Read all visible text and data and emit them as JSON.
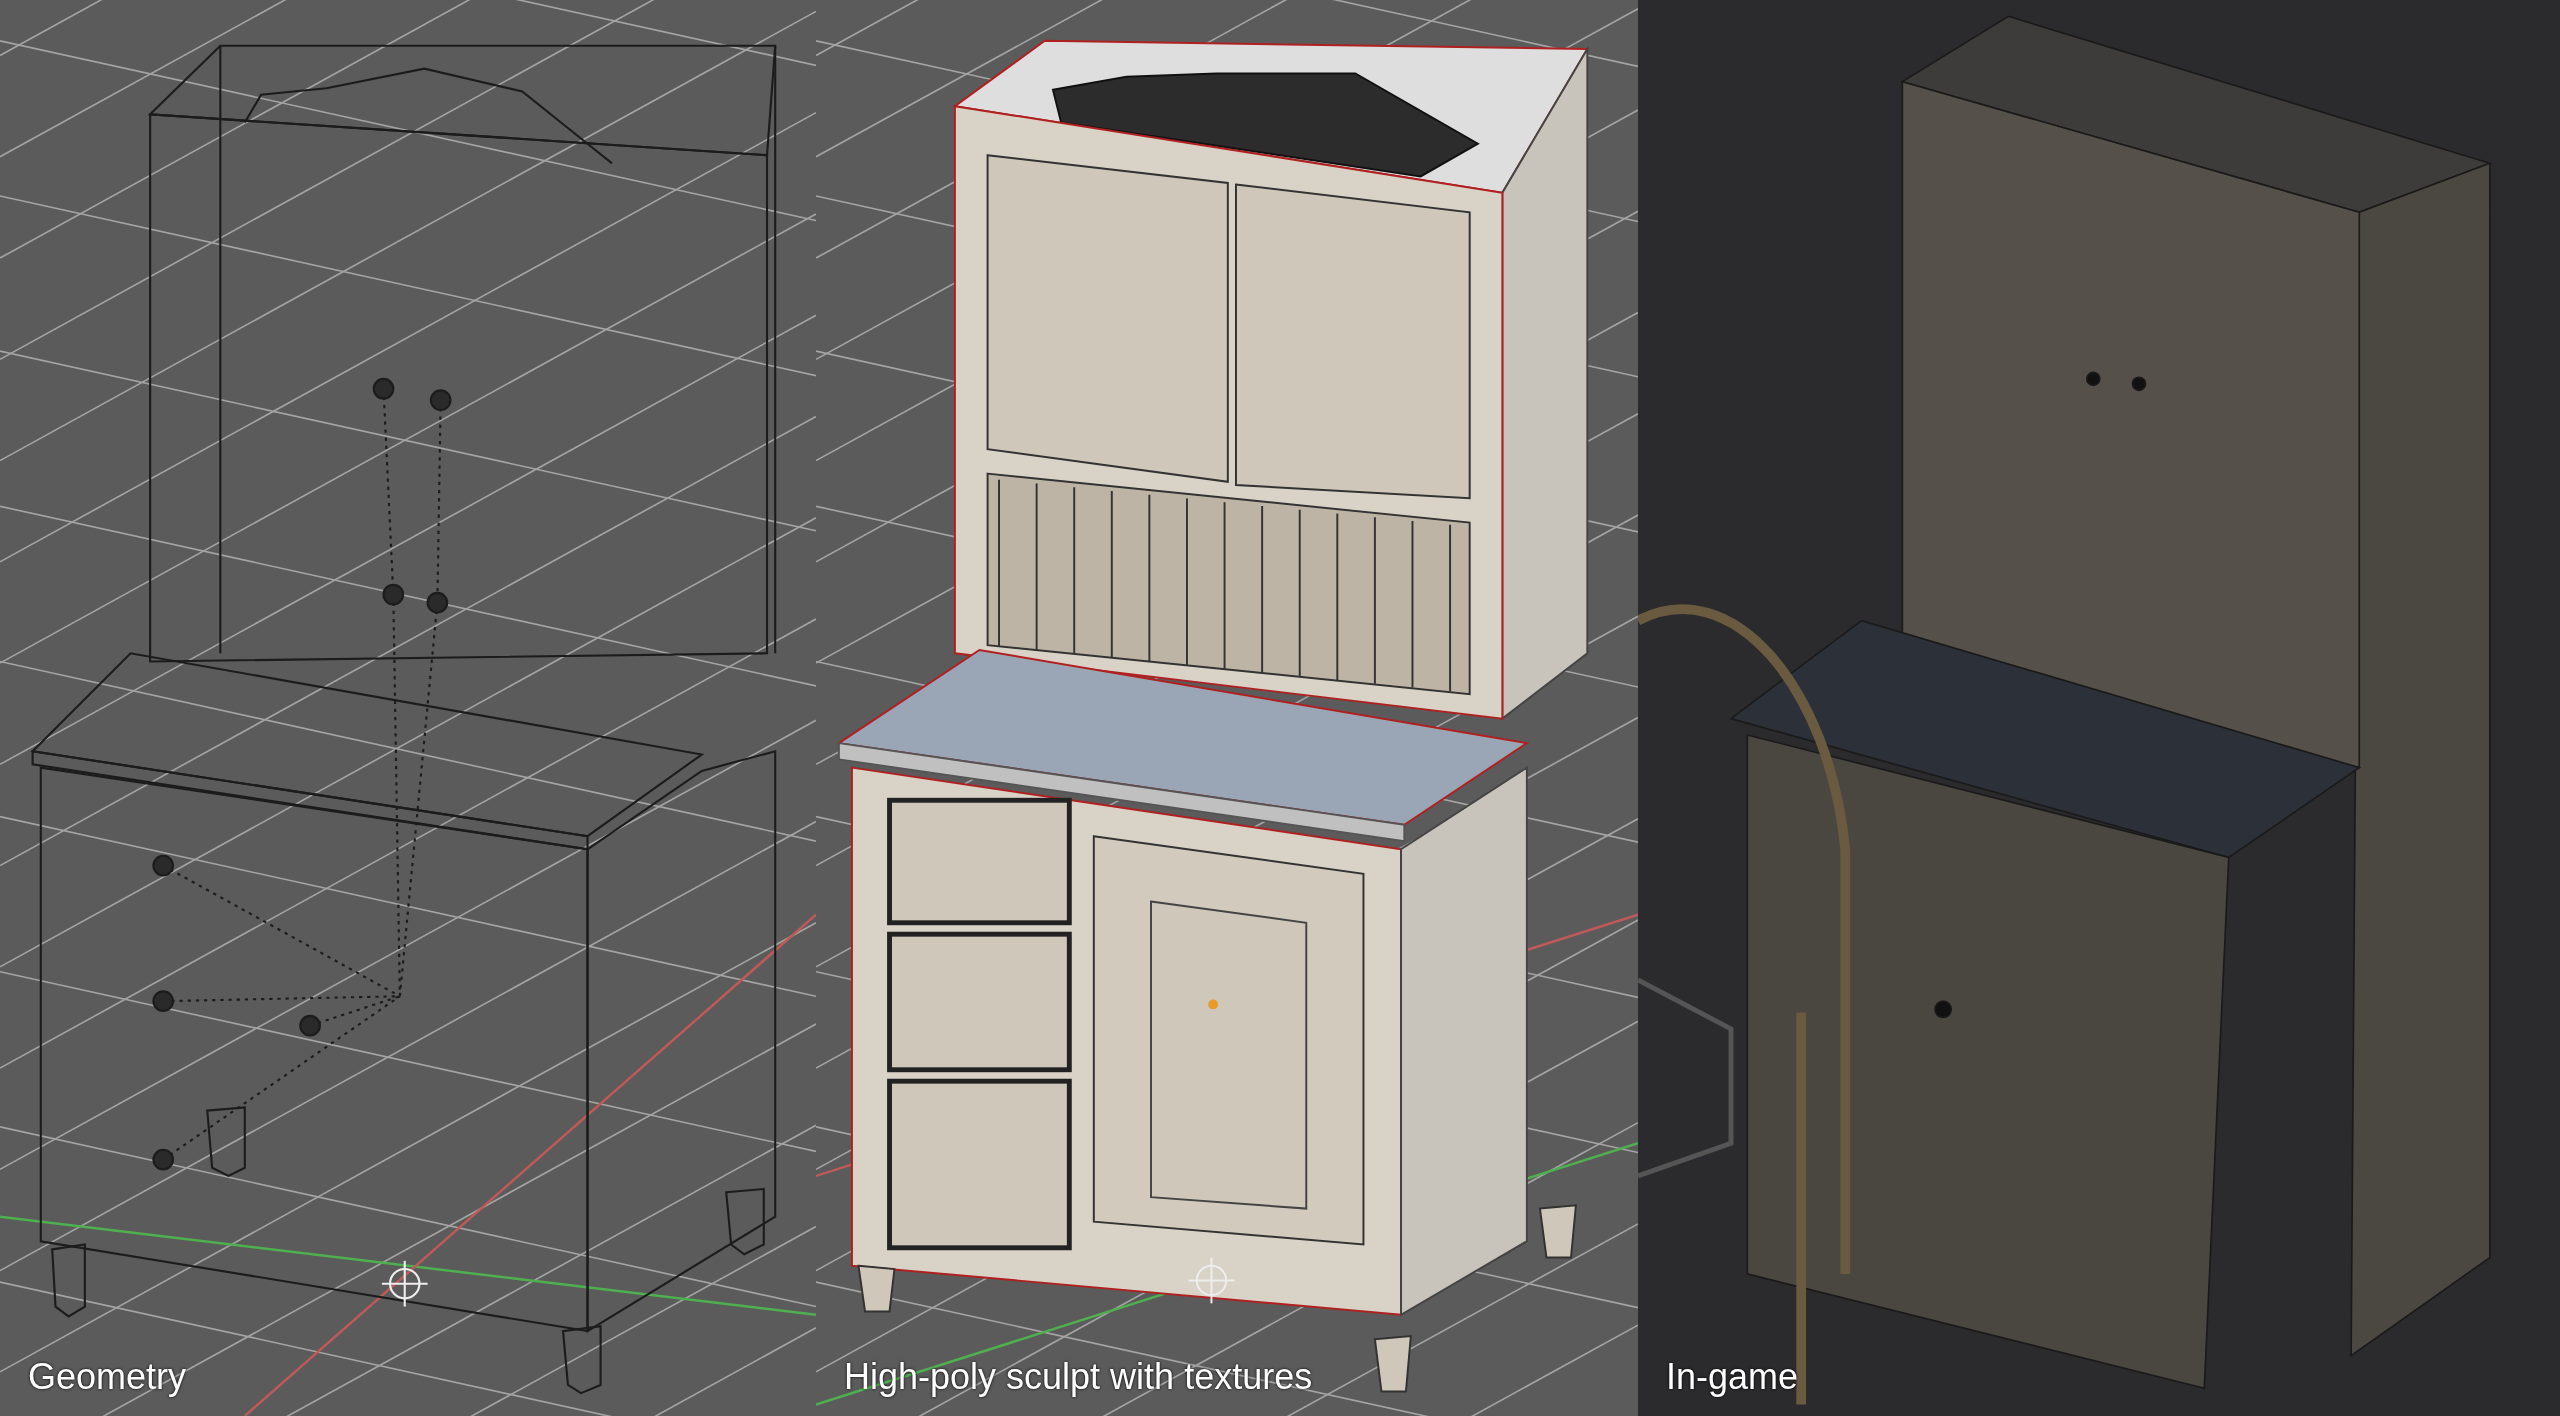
{
  "panels": [
    {
      "kind": "wireframe",
      "caption": "Geometry"
    },
    {
      "kind": "textured",
      "caption": "High-poly sculpt with textures"
    },
    {
      "kind": "game",
      "caption": "In-game"
    }
  ]
}
